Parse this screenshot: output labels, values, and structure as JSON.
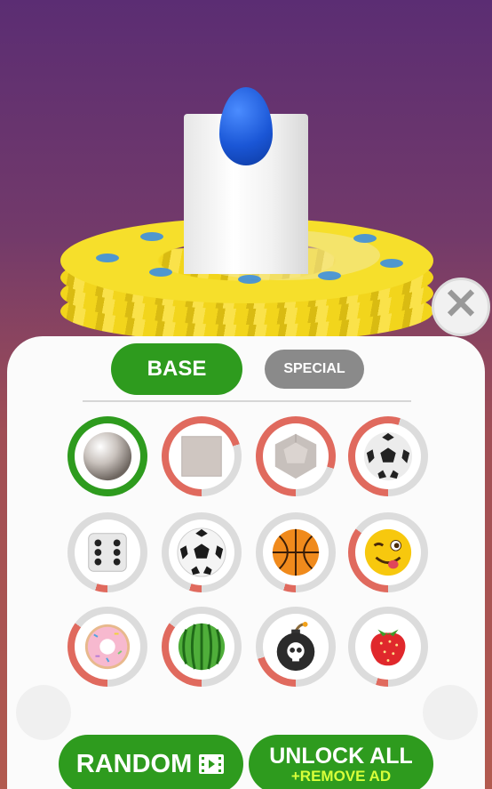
{
  "scene": {
    "ball_color": "#1a56d6",
    "ring_color": "#f6df2b",
    "tower_color": "#ffffff"
  },
  "close_button": {
    "icon": "close-icon",
    "glyph": "✕"
  },
  "tabs": [
    {
      "label": "BASE",
      "active": true
    },
    {
      "label": "SPECIAL",
      "active": false
    }
  ],
  "skins": [
    {
      "name": "pearl-ball",
      "selected": true,
      "progress": 1.0
    },
    {
      "name": "cube",
      "selected": false,
      "progress": 0.7
    },
    {
      "name": "dodecahedron",
      "selected": false,
      "progress": 0.8
    },
    {
      "name": "soccer-ball-dark",
      "selected": false,
      "progress": 0.55
    },
    {
      "name": "dice",
      "selected": false,
      "progress": 0.05
    },
    {
      "name": "soccer-ball",
      "selected": false,
      "progress": 0.05
    },
    {
      "name": "basketball",
      "selected": false,
      "progress": 0.05
    },
    {
      "name": "winking-emoji",
      "selected": false,
      "progress": 0.35
    },
    {
      "name": "donut",
      "selected": false,
      "progress": 0.35
    },
    {
      "name": "watermelon",
      "selected": false,
      "progress": 0.35
    },
    {
      "name": "skull-bomb",
      "selected": false,
      "progress": 0.2
    },
    {
      "name": "strawberry",
      "selected": false,
      "progress": 0.05
    }
  ],
  "colors": {
    "primary_green": "#2e9b1e",
    "progress_red": "#e06a5e",
    "inactive_gray": "#8a8a8a",
    "accent_yellow": "#d7ff3a"
  },
  "buttons": {
    "random_label": "RANDOM",
    "random_icon": "video-ad-icon",
    "unlock_label": "UNLOCK ALL",
    "unlock_sub": "+REMOVE AD"
  }
}
